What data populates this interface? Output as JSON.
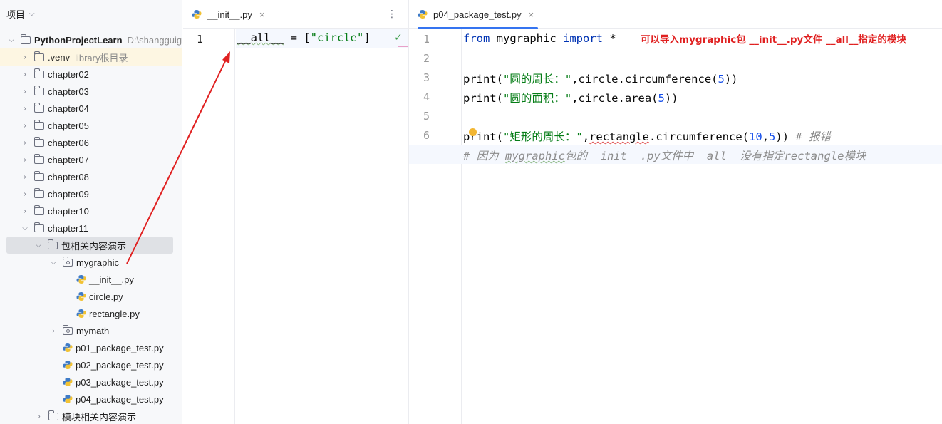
{
  "sidebar": {
    "title": "项目",
    "root": {
      "name": "PythonProjectLearn",
      "path": "D:\\shangguig"
    },
    "venv": {
      "name": ".venv",
      "note": "library根目录"
    },
    "chapters": [
      "chapter02",
      "chapter03",
      "chapter04",
      "chapter05",
      "chapter06",
      "chapter07",
      "chapter08",
      "chapter09",
      "chapter10",
      "chapter11"
    ],
    "pkg_demo": "包相关内容演示",
    "mygraphic": "mygraphic",
    "mygraphic_files": [
      "__init__.py",
      "circle.py",
      "rectangle.py"
    ],
    "mymath": "mymath",
    "tests": [
      "p01_package_test.py",
      "p02_package_test.py",
      "p03_package_test.py",
      "p04_package_test.py"
    ],
    "module_demo": "模块相关内容演示"
  },
  "left_editor": {
    "tab": "__init__.py",
    "close": "×",
    "more": "⋮",
    "line_numbers": [
      "1"
    ],
    "code": {
      "name": "__all__",
      "op": " = [",
      "str": "\"circle\"",
      "end": "]"
    },
    "check": "✓"
  },
  "right_editor": {
    "tab": "p04_package_test.py",
    "close": "×",
    "line_numbers": [
      "1",
      "2",
      "3",
      "4",
      "5",
      "6",
      "7"
    ],
    "line1": {
      "kw1": "from",
      "mod": " mygraphic ",
      "kw2": "import",
      "star": " *"
    },
    "line3": {
      "fn": "print",
      "p1": "(",
      "str": "\"圆的周长：\"",
      "mid": ",circle.circumference(",
      "num": "5",
      "end": "))"
    },
    "line4": {
      "fn": "print",
      "p1": "(",
      "str": "\"圆的面积：\"",
      "mid": ",circle.area(",
      "num": "5",
      "end": "))"
    },
    "line6": {
      "fn_a": "p",
      "fn_b": "rint",
      "p1": "(",
      "str": "\"矩形的周长：\"",
      "comma": ",",
      "obj": "rectangle",
      "mid": ".circumference(",
      "n1": "10",
      "c": ",",
      "n2": "5",
      "end": "))",
      "cm": " # 报错"
    },
    "line7": {
      "cm_a": "# 因为 ",
      "cm_b": "mygraphic",
      "cm_c": "包的__init__.py文件中__all__没有指定rectangle模块"
    },
    "annotation": "可以导入mygraphic包 __init__.py文件 __all__指定的模块"
  },
  "colors": {
    "annotation": "#e02020",
    "accent": "#3574f0",
    "arrow": "#e02020"
  }
}
